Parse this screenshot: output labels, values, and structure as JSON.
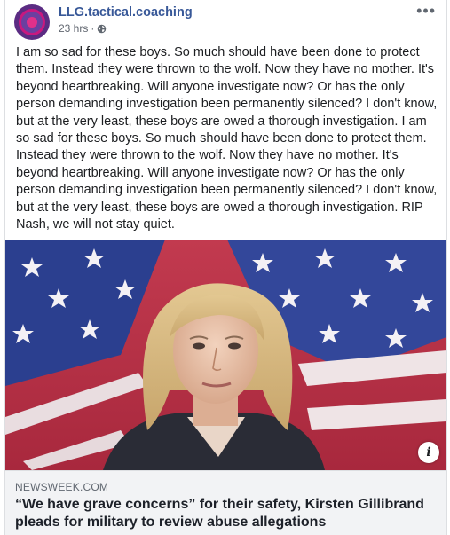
{
  "post": {
    "page_name": "LLG.tactical.coaching",
    "timestamp": "23 hrs",
    "separator": "·",
    "privacy_icon": "globe-icon",
    "more_label": "•••",
    "text": "I am so sad for these boys. So much should have been done to protect them. Instead they were thrown to the wolf. Now they have no mother. It's beyond heartbreaking. Will anyone investigate now? Or has the only person demanding investigation been permanently silenced? I don't know, but at the very least, these boys are owed a thorough investigation. I am so sad for these boys. So much should have been done to protect them. Instead they were thrown to the wolf. Now they have no mother. It's beyond heartbreaking. Will anyone investigate now? Or has the only person demanding investigation been permanently silenced? I don't know, but at the very least, these boys are owed a thorough investigation. RIP Nash, we will not stay quiet."
  },
  "link_preview": {
    "info_label": "i",
    "domain": "NEWSWEEK.COM",
    "headline": "“We have grave concerns” for their safety, Kirsten Gillibrand pleads for military to review abuse allegations"
  },
  "colors": {
    "page_name": "#385898",
    "meta": "#616770",
    "link_box_bg": "#f2f3f5"
  }
}
